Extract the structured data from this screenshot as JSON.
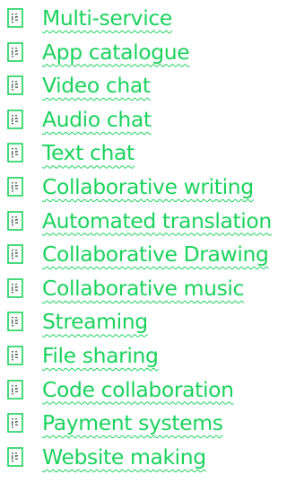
{
  "colors": {
    "accent": "#1bd35c",
    "icon_dark": "#5b6b60"
  },
  "items": [
    {
      "label": "Multi-service",
      "icon": "document-icon"
    },
    {
      "label": "App catalogue",
      "icon": "document-icon"
    },
    {
      "label": "Video chat",
      "icon": "document-icon"
    },
    {
      "label": "Audio chat",
      "icon": "document-icon"
    },
    {
      "label": "Text chat",
      "icon": "document-icon"
    },
    {
      "label": "Collaborative writing",
      "icon": "document-icon"
    },
    {
      "label": "Automated translation",
      "icon": "document-icon"
    },
    {
      "label": "Collaborative Drawing",
      "icon": "document-icon"
    },
    {
      "label": "Collaborative music",
      "icon": "document-icon"
    },
    {
      "label": "Streaming",
      "icon": "document-icon"
    },
    {
      "label": "File sharing",
      "icon": "document-icon"
    },
    {
      "label": "Code collaboration",
      "icon": "document-icon"
    },
    {
      "label": "Payment systems",
      "icon": "document-icon"
    },
    {
      "label": "Website making",
      "icon": "document-icon"
    }
  ]
}
